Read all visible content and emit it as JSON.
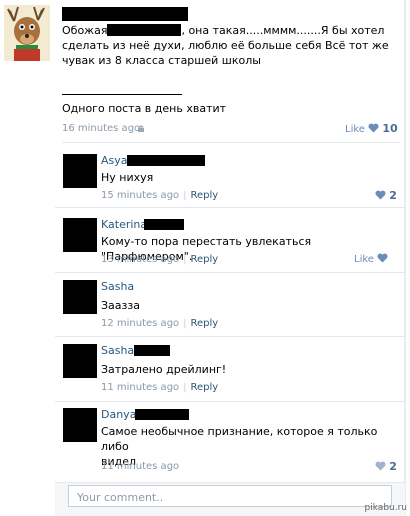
{
  "post": {
    "text_line1_a": "Обожая",
    "text_line1_b": ", она такая.....мммм.......Я бы хотел",
    "text_line2": "сделать из неё духи, люблю её больше себя Всё тот же",
    "text_line3": "чувак из 8 класса старшей школы",
    "text_line4": "Одного поста в день хватит",
    "time": "16 minutes ago",
    "like_label": "Like",
    "like_count": "10"
  },
  "comments": [
    {
      "name": "Asya",
      "text": "Ну нихуя",
      "time": "15 minutes ago",
      "reply": "Reply",
      "like_count": "2"
    },
    {
      "name": "Katerina",
      "text": "Кому-то пора перестать увлекаться \"Парфюмером\".",
      "time": "13 minutes ago",
      "reply": "Reply",
      "like_label": "Like"
    },
    {
      "name": "Sasha",
      "text": "Заазза",
      "time": "12 minutes ago",
      "reply": "Reply"
    },
    {
      "name": "Sasha",
      "text": "Затралено дрейлинг!",
      "time": "11 minutes ago",
      "reply": "Reply"
    },
    {
      "name": "Danya",
      "text_line1": "Самое необычное признание, которое я только либо",
      "text_line2": "видел",
      "time": "11 minutes ago",
      "like_count": "2"
    }
  ],
  "composer": {
    "placeholder": "Your comment.."
  },
  "watermark": "pikabu.ru",
  "colors": {
    "name": "#2b587a",
    "meta": "#8a9aa8",
    "like": "#6a8db8"
  }
}
